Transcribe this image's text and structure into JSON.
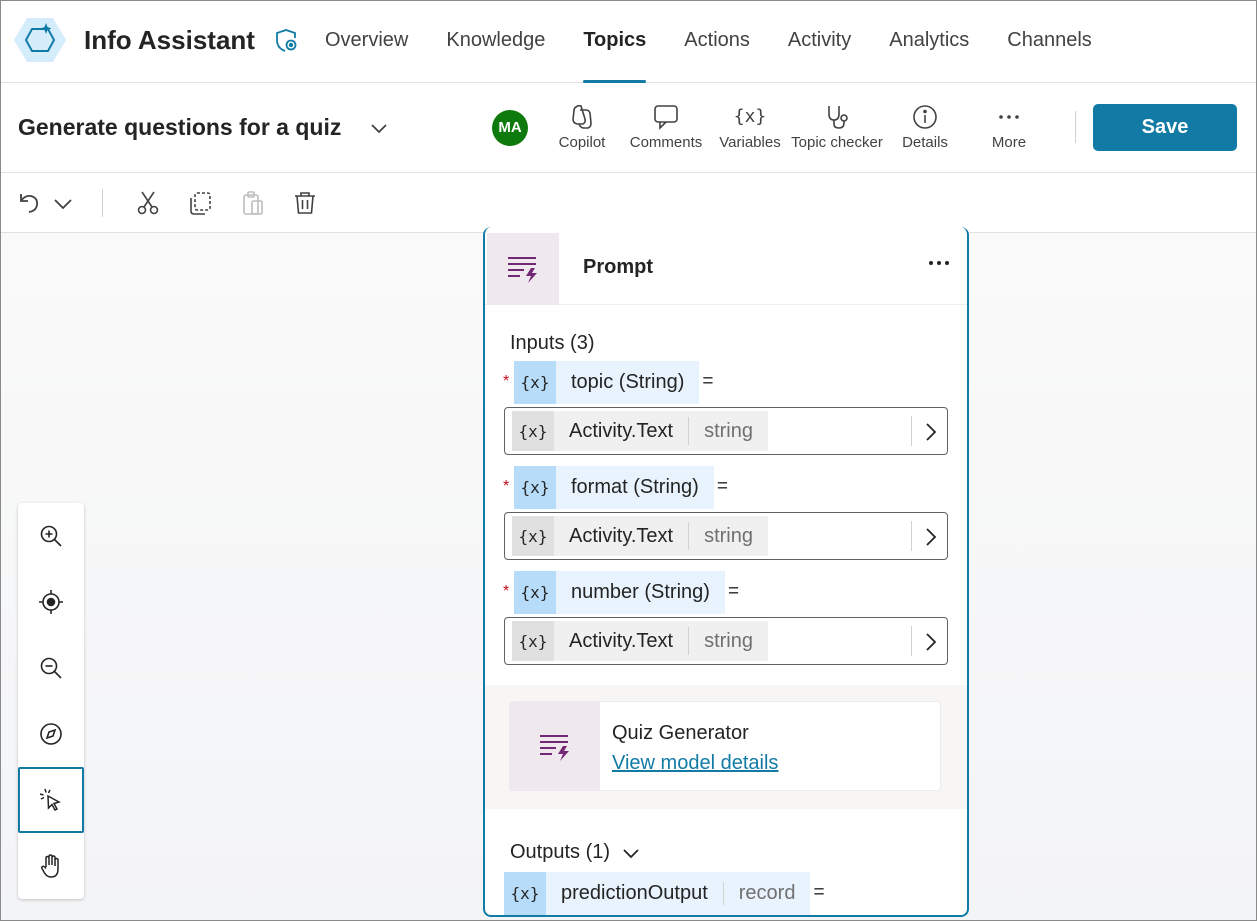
{
  "app": {
    "title": "Info Assistant"
  },
  "nav": {
    "tabs": [
      {
        "label": "Overview"
      },
      {
        "label": "Knowledge"
      },
      {
        "label": "Topics",
        "active": true
      },
      {
        "label": "Actions"
      },
      {
        "label": "Activity"
      },
      {
        "label": "Analytics"
      },
      {
        "label": "Channels"
      }
    ]
  },
  "topic": {
    "name": "Generate questions for a quiz",
    "avatar_initials": "MA",
    "tools": {
      "copilot": "Copilot",
      "comments": "Comments",
      "variables": "Variables",
      "variables_icon": "{x}",
      "topic_checker": "Topic checker",
      "details": "Details",
      "more": "More"
    },
    "save_label": "Save"
  },
  "node": {
    "title": "Prompt",
    "inputs_label": "Inputs (3)",
    "var_glyph": "{x}",
    "equals": "=",
    "required_mark": "*",
    "inputs": [
      {
        "name": "topic (String)",
        "value": "Activity.Text",
        "type": "string"
      },
      {
        "name": "format (String)",
        "value": "Activity.Text",
        "type": "string"
      },
      {
        "name": "number (String)",
        "value": "Activity.Text",
        "type": "string"
      }
    ],
    "model": {
      "name": "Quiz Generator",
      "link": "View model details"
    },
    "outputs_label": "Outputs (1)",
    "output": {
      "name": "predictionOutput",
      "type": "record"
    }
  },
  "colors": {
    "accent": "#117ba5",
    "avatar": "#0e7a0d",
    "prompt_icon": "#742774",
    "required": "#c50f1f"
  }
}
